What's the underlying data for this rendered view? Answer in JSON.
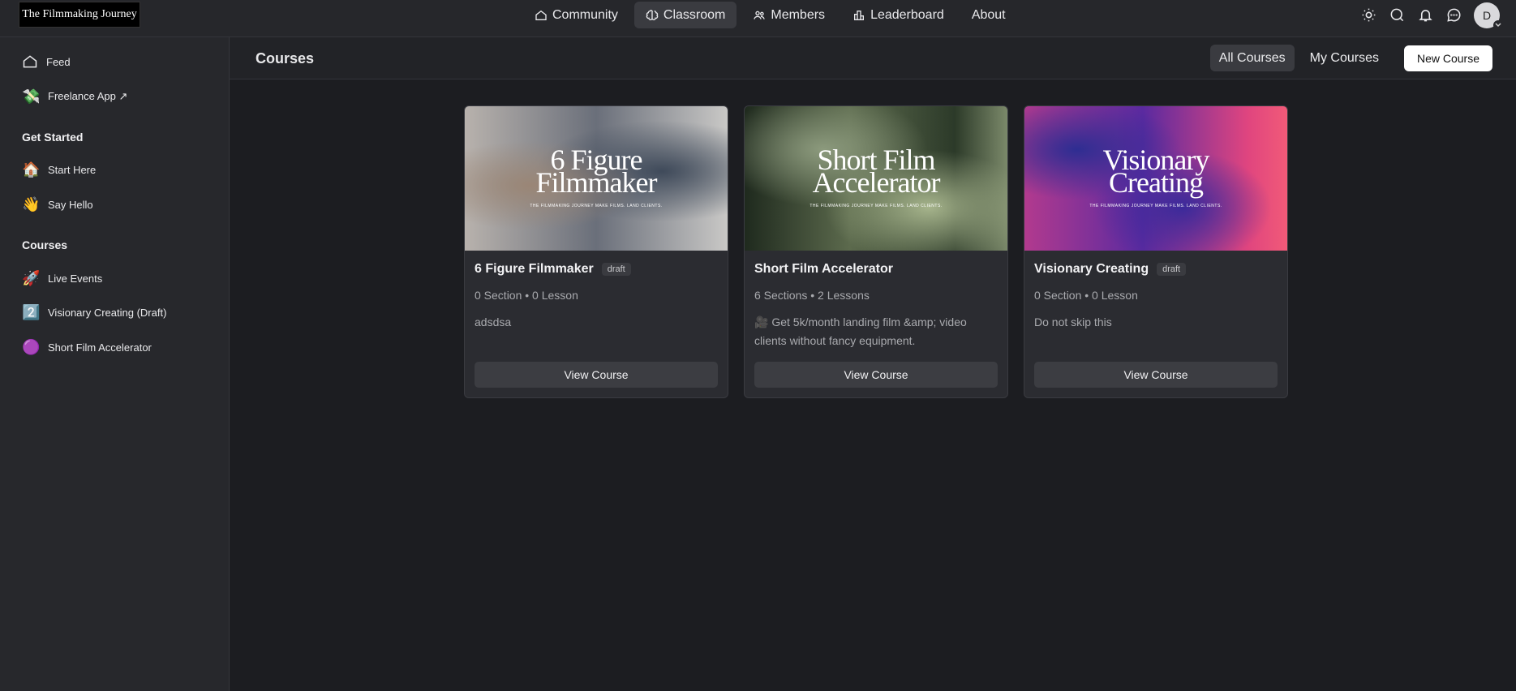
{
  "brand": {
    "logo_text": "The Filmmaking Journey"
  },
  "nav": [
    {
      "label": "Community",
      "icon": "home-icon"
    },
    {
      "label": "Classroom",
      "icon": "brain-icon",
      "active": true
    },
    {
      "label": "Members",
      "icon": "users-icon"
    },
    {
      "label": "Leaderboard",
      "icon": "bar-chart-icon"
    },
    {
      "label": "About",
      "icon": ""
    }
  ],
  "top_icons": [
    "sun-icon",
    "search-icon",
    "bell-icon",
    "chat-icon"
  ],
  "user": {
    "avatar_letter": "D"
  },
  "sidebar": {
    "feed": "Feed",
    "freelance": "Freelance App ↗",
    "freelance_emoji": "💸",
    "get_started_heading": "Get Started",
    "start_here": "Start Here",
    "start_here_emoji": "🏠",
    "say_hello": "Say Hello",
    "say_hello_emoji": "👋",
    "courses_heading": "Courses",
    "live_events": "Live Events",
    "live_events_emoji": "🚀",
    "visionary": "Visionary Creating (Draft)",
    "visionary_emoji": "2️⃣",
    "short_film": "Short Film Accelerator",
    "short_film_emoji": "🟣"
  },
  "subheader": {
    "title": "Courses",
    "all_courses": "All Courses",
    "my_courses": "My Courses",
    "new_course": "New Course"
  },
  "courses": [
    {
      "thumb_line1": "6 Figure",
      "thumb_line2": "Filmmaker",
      "thumb_tag": "THE FILMMAKING JOURNEY     MAKE FILMS. LAND CLIENTS.",
      "title": "6 Figure Filmmaker",
      "badge": "draft",
      "meta": "0 Section • 0 Lesson",
      "desc": "adsdsa",
      "button": "View Course"
    },
    {
      "thumb_line1": "Short Film",
      "thumb_line2": "Accelerator",
      "thumb_tag": "THE FILMMAKING JOURNEY     MAKE FILMS. LAND CLIENTS.",
      "title": "Short Film Accelerator",
      "badge": "",
      "meta": "6 Sections • 2 Lessons",
      "desc": "🎥 Get 5k/month landing film &amp; video clients without fancy equipment.",
      "button": "View Course"
    },
    {
      "thumb_line1": "Visionary",
      "thumb_line2": "Creating",
      "thumb_tag": "THE FILMMAKING JOURNEY     MAKE FILMS. LAND CLIENTS.",
      "title": "Visionary Creating",
      "badge": "draft",
      "meta": "0 Section • 0 Lesson",
      "desc": "Do not skip this",
      "button": "View Course"
    }
  ]
}
